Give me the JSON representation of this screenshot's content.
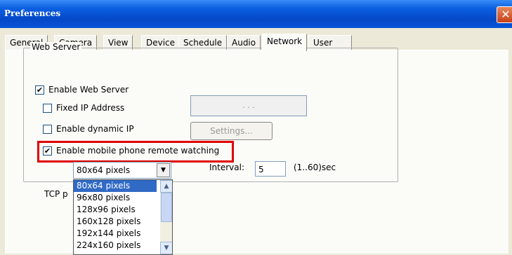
{
  "window": {
    "title": "Preferences",
    "close_glyph": "✕"
  },
  "tabs": [
    "General",
    "Camera",
    "View",
    "Device",
    "Schedule",
    "Audio",
    "Network",
    "User"
  ],
  "active_tab": "Network",
  "web_server": {
    "group_title": "Web Server",
    "enable_web_server": {
      "label": "Enable Web Server",
      "checked": true
    },
    "fixed_ip": {
      "label": "Fixed IP Address",
      "checked": false,
      "value": ".      .      ."
    },
    "dynamic_ip": {
      "label": "Enable dynamic IP",
      "checked": false
    },
    "settings_button": "Settings...",
    "mobile_watching": {
      "label": "Enable mobile phone remote watching",
      "checked": true
    },
    "resolution": {
      "selected": "80x64 pixels",
      "options": [
        "80x64 pixels",
        "96x80 pixels",
        "128x96 pixels",
        "160x128 pixels",
        "192x144 pixels",
        "224x160 pixels"
      ]
    },
    "interval": {
      "label": "Interval:",
      "value": "5",
      "range": "(1..60)sec"
    },
    "tcp_label": "TCP p"
  },
  "colors": {
    "highlight_box": "#e00000",
    "titlebar": "#0548c8",
    "selection": "#316ac5"
  }
}
